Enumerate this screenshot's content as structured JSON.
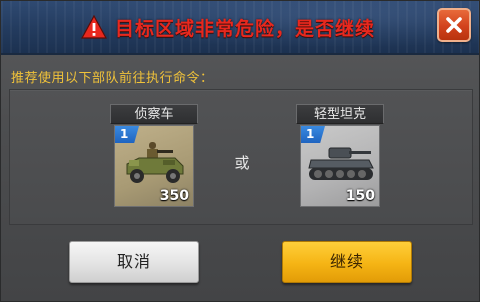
{
  "dialog": {
    "title": "目标区域非常危险，是否继续",
    "close_icon": "close-icon",
    "warning_icon": "warning-triangle-icon"
  },
  "prompt": "推荐使用以下部队前往执行命令：",
  "units": [
    {
      "name": "侦察车",
      "tier": "1",
      "count": "350",
      "icon": "recon-jeep-icon"
    },
    {
      "name": "轻型坦克",
      "tier": "1",
      "count": "150",
      "icon": "light-tank-icon"
    }
  ],
  "separator": "或",
  "buttons": {
    "cancel": "取消",
    "continue": "继续"
  },
  "colors": {
    "title": "#e8281e",
    "prompt": "#f0c23a",
    "continue": "#f5b414",
    "tier_badge": "#2a74d0"
  }
}
